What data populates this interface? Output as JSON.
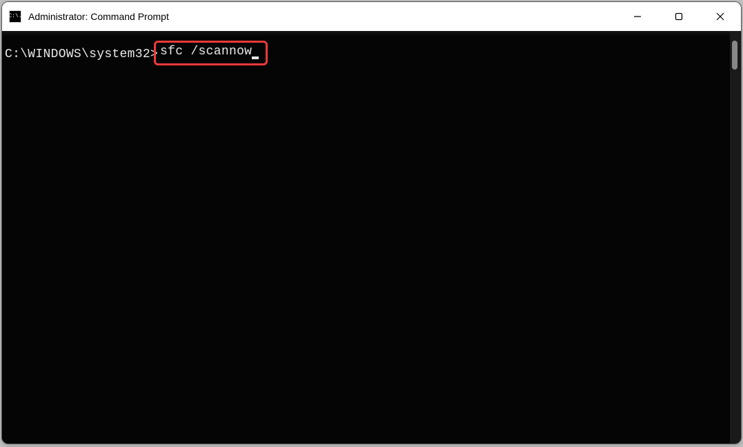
{
  "window": {
    "title": "Administrator: Command Prompt",
    "app_icon_text": "C:\\."
  },
  "terminal": {
    "prompt": "C:\\WINDOWS\\system32>",
    "command": "sfc /scannow"
  },
  "highlight": {
    "color": "#ef3a3a"
  }
}
